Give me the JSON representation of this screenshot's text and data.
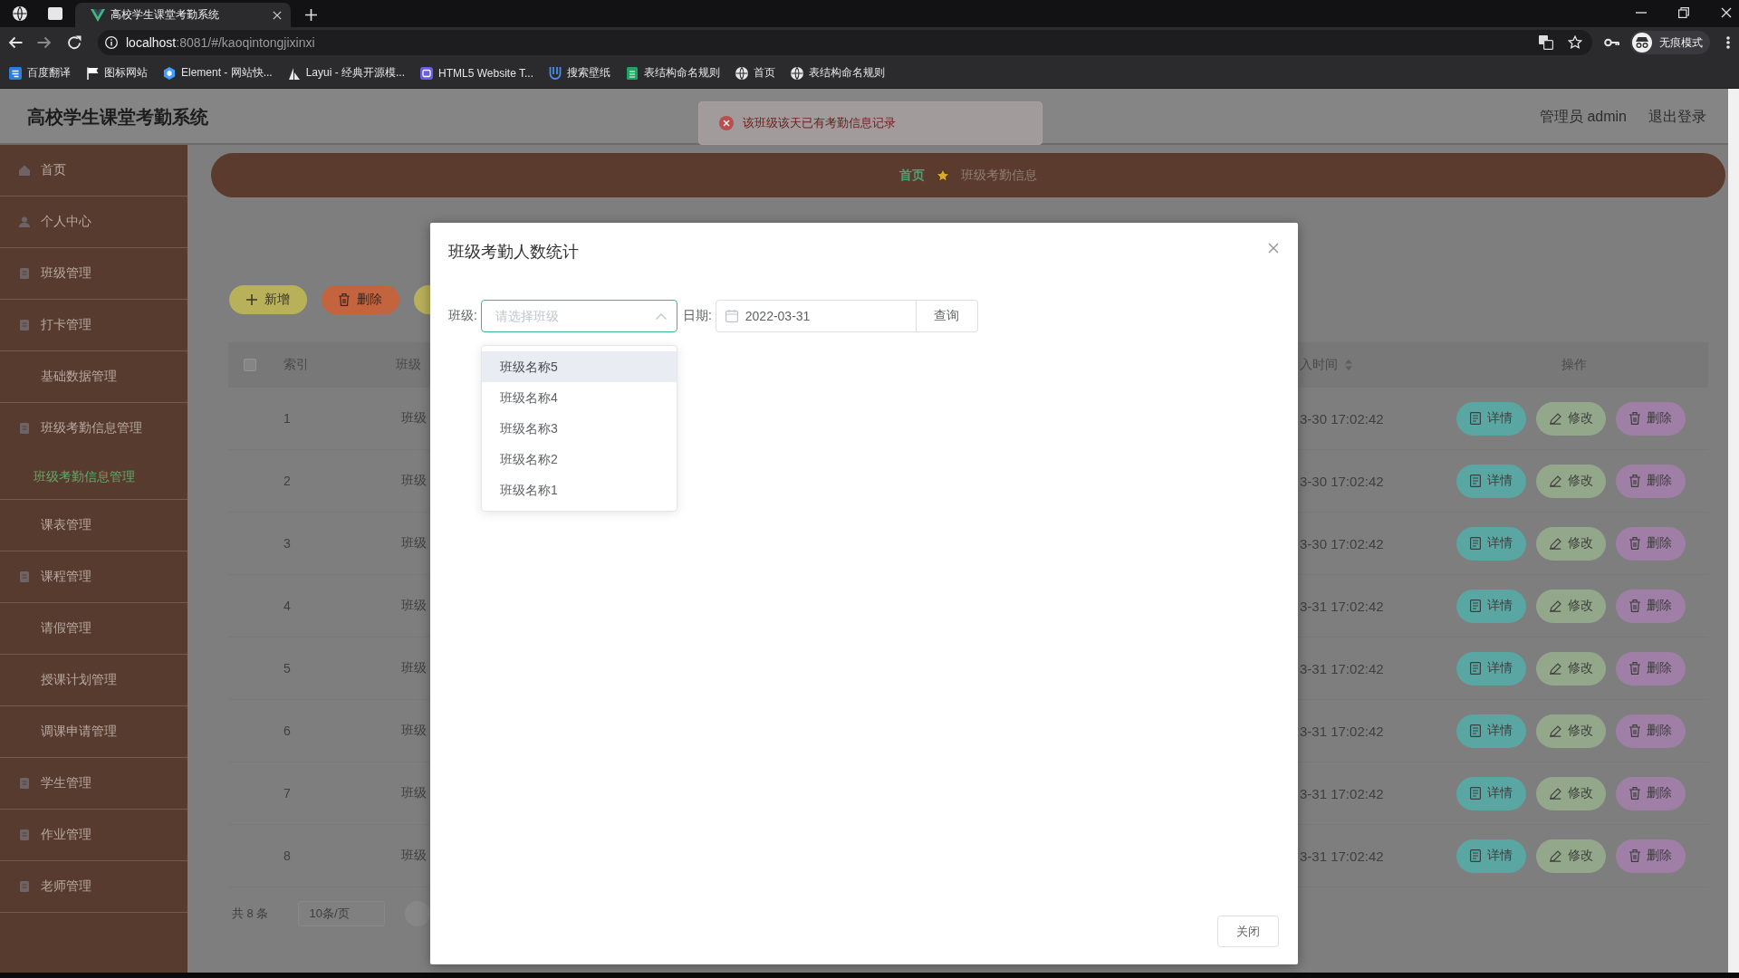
{
  "browser": {
    "tabs": [
      {
        "title": "高校学生课堂考勤系统",
        "selected": true
      }
    ],
    "address": {
      "host": "localhost",
      "rest": ":8081/#/kaoqintongjixinxi"
    },
    "profile": {
      "label": "无痕模式"
    },
    "bookmarks": [
      {
        "label": "百度翻译"
      },
      {
        "label": "图标网站"
      },
      {
        "label": "Element - 网站快..."
      },
      {
        "label": "Layui - 经典开源模..."
      },
      {
        "label": "HTML5 Website T..."
      },
      {
        "label": "搜索壁纸"
      },
      {
        "label": "表结构命名规则"
      },
      {
        "label": "首页"
      },
      {
        "label": "表结构命名规则"
      }
    ]
  },
  "header": {
    "title": "高校学生课堂考勤系统",
    "user": "管理员 admin",
    "logout": "退出登录"
  },
  "toast": {
    "kind": "error",
    "message": "该班级该天已有考勤信息记录"
  },
  "sidebar": {
    "items": [
      {
        "label": "首页",
        "selected": false
      },
      {
        "label": "个人中心",
        "selected": false
      },
      {
        "label": "班级管理",
        "selected": false
      },
      {
        "label": "打卡管理",
        "selected": false
      },
      {
        "label": "基础数据管理",
        "selected": false
      },
      {
        "label": "班级考勤信息管理",
        "selected": false,
        "expanded": true,
        "children": [
          {
            "label": "班级考勤信息管理",
            "selected": true
          }
        ]
      },
      {
        "label": "课表管理",
        "selected": false
      },
      {
        "label": "课程管理",
        "selected": false
      },
      {
        "label": "请假管理",
        "selected": false
      },
      {
        "label": "授课计划管理",
        "selected": false
      },
      {
        "label": "调课申请管理",
        "selected": false
      },
      {
        "label": "学生管理",
        "selected": false
      },
      {
        "label": "作业管理",
        "selected": false
      },
      {
        "label": "老师管理",
        "selected": false
      }
    ]
  },
  "breadcrumb": [
    {
      "label": "首页",
      "current": false
    },
    {
      "label": "班级考勤信息",
      "current": true
    }
  ],
  "toolbar": {
    "buttons": [
      {
        "kind": "add",
        "label": "新增"
      },
      {
        "kind": "delete",
        "label": "删除"
      },
      {
        "kind": "warning"
      }
    ]
  },
  "table": {
    "select_all": {
      "checked": false
    },
    "columns": [
      {
        "label": "索引"
      },
      {
        "label": "班级"
      },
      {
        "label": "入时间",
        "sortable": true
      },
      {
        "label": "操作"
      }
    ],
    "rows": [
      {
        "index": "1",
        "class_name": "班级",
        "time": "3-30 17:02:42",
        "actions": [
          {
            "kind": "detail",
            "label": "详情"
          },
          {
            "kind": "edit",
            "label": "修改"
          },
          {
            "kind": "delete",
            "label": "删除"
          }
        ]
      },
      {
        "index": "2",
        "class_name": "班级",
        "time": "3-30 17:02:42",
        "actions": [
          {
            "kind": "detail",
            "label": "详情"
          },
          {
            "kind": "edit",
            "label": "修改"
          },
          {
            "kind": "delete",
            "label": "删除"
          }
        ]
      },
      {
        "index": "3",
        "class_name": "班级",
        "time": "3-30 17:02:42",
        "actions": [
          {
            "kind": "detail",
            "label": "详情"
          },
          {
            "kind": "edit",
            "label": "修改"
          },
          {
            "kind": "delete",
            "label": "删除"
          }
        ]
      },
      {
        "index": "4",
        "class_name": "班级",
        "time": "3-31 17:02:42",
        "actions": [
          {
            "kind": "detail",
            "label": "详情"
          },
          {
            "kind": "edit",
            "label": "修改"
          },
          {
            "kind": "delete",
            "label": "删除"
          }
        ]
      },
      {
        "index": "5",
        "class_name": "班级",
        "time": "3-31 17:02:42",
        "actions": [
          {
            "kind": "detail",
            "label": "详情"
          },
          {
            "kind": "edit",
            "label": "修改"
          },
          {
            "kind": "delete",
            "label": "删除"
          }
        ]
      },
      {
        "index": "6",
        "class_name": "班级",
        "time": "3-31 17:02:42",
        "actions": [
          {
            "kind": "detail",
            "label": "详情"
          },
          {
            "kind": "edit",
            "label": "修改"
          },
          {
            "kind": "delete",
            "label": "删除"
          }
        ]
      },
      {
        "index": "7",
        "class_name": "班级",
        "time": "3-31 17:02:42",
        "actions": [
          {
            "kind": "detail",
            "label": "详情"
          },
          {
            "kind": "edit",
            "label": "修改"
          },
          {
            "kind": "delete",
            "label": "删除"
          }
        ]
      },
      {
        "index": "8",
        "class_name": "班级",
        "time": "3-31 17:02:42",
        "actions": [
          {
            "kind": "detail",
            "label": "详情"
          },
          {
            "kind": "edit",
            "label": "修改"
          },
          {
            "kind": "delete",
            "label": "删除"
          }
        ]
      }
    ]
  },
  "pagination": {
    "total": "共 8 条",
    "page_size": "10条/页"
  },
  "dialog": {
    "title": "班级考勤人数统计",
    "class_label": "班级:",
    "class_select": {
      "placeholder": "请选择班级",
      "open": true,
      "options": [
        {
          "label": "班级名称5",
          "highlighted": true
        },
        {
          "label": "班级名称4",
          "highlighted": false
        },
        {
          "label": "班级名称3",
          "highlighted": false
        },
        {
          "label": "班级名称2",
          "highlighted": false
        },
        {
          "label": "班级名称1",
          "highlighted": false
        }
      ]
    },
    "date_label": "日期:",
    "date_field": {
      "value": "2022-03-31"
    },
    "query_button": "查询",
    "close_button": "关闭"
  }
}
